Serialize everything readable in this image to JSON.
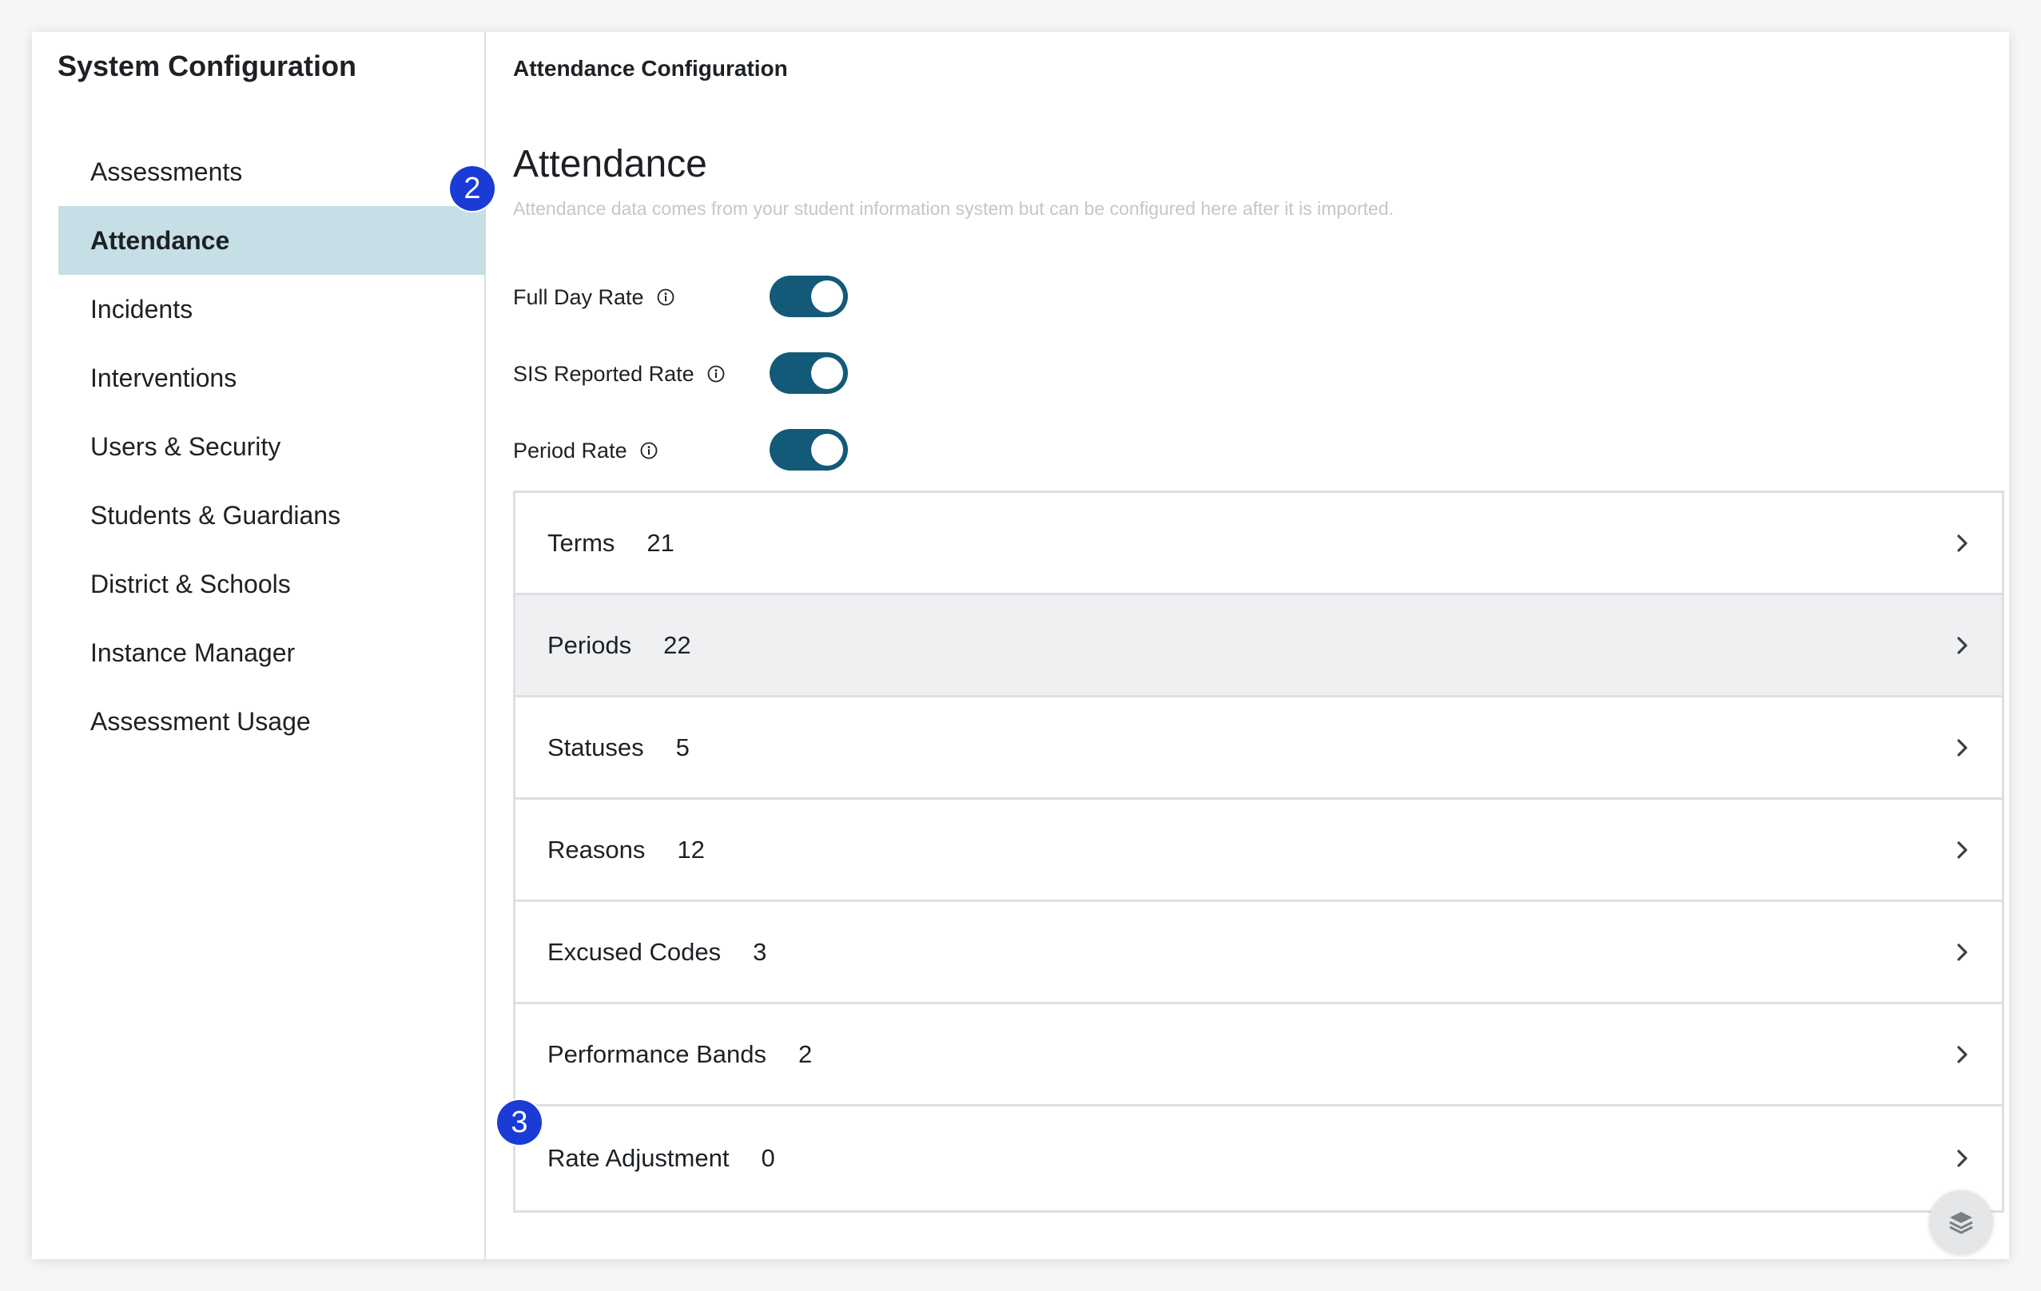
{
  "sidebar": {
    "title": "System Configuration",
    "items": [
      {
        "label": "Assessments"
      },
      {
        "label": "Attendance"
      },
      {
        "label": "Incidents"
      },
      {
        "label": "Interventions"
      },
      {
        "label": "Users & Security"
      },
      {
        "label": "Students & Guardians"
      },
      {
        "label": "District & Schools"
      },
      {
        "label": "Instance Manager"
      },
      {
        "label": "Assessment Usage"
      }
    ],
    "active_item": "Attendance"
  },
  "badges": {
    "step_2": "2",
    "step_3": "3"
  },
  "main": {
    "breadcrumb": "Attendance Configuration",
    "title": "Attendance",
    "subtitle": "Attendance data comes from your student information system but can be configured here after it is imported.",
    "toggles": [
      {
        "label": "Full Day Rate",
        "on": true
      },
      {
        "label": "SIS Reported Rate",
        "on": true
      },
      {
        "label": "Period Rate",
        "on": true
      }
    ],
    "rows": [
      {
        "label": "Terms",
        "count": "21"
      },
      {
        "label": "Periods",
        "count": "22"
      },
      {
        "label": "Statuses",
        "count": "5"
      },
      {
        "label": "Reasons",
        "count": "12"
      },
      {
        "label": "Excused Codes",
        "count": "3"
      },
      {
        "label": "Performance Bands",
        "count": "2"
      },
      {
        "label": "Rate Adjustment",
        "count": "0"
      }
    ],
    "hovered_row": "Periods"
  },
  "colors": {
    "accent": "#135a78",
    "active_nav": "#c6dfe6",
    "badge": "#1a3bd6",
    "hover_row": "#eff0f2"
  },
  "icons": {
    "info": "info-icon",
    "chevron": "chevron-right-icon",
    "fab": "layers-icon"
  }
}
